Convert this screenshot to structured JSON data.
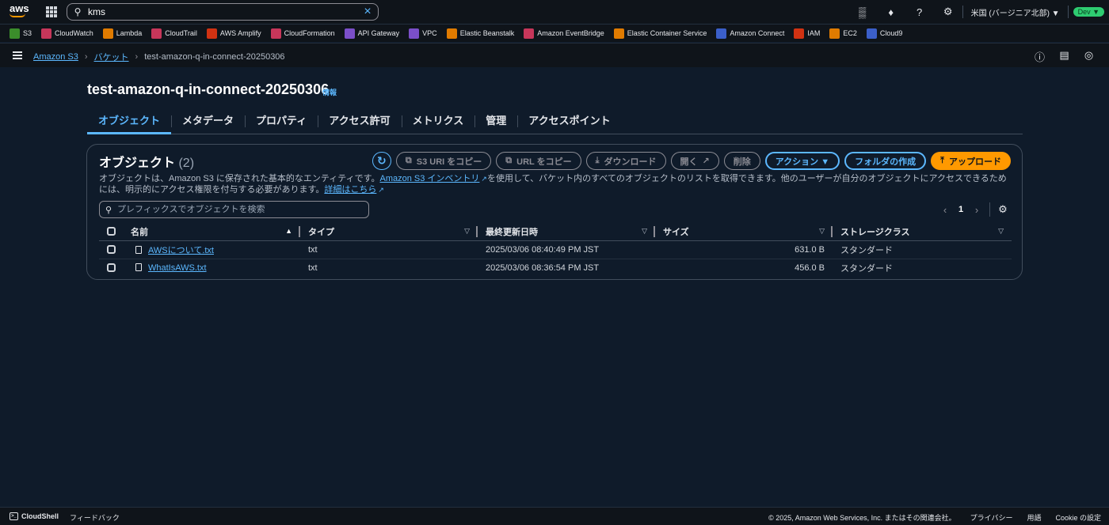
{
  "topnav": {
    "logo": "aws",
    "search_value": "kms",
    "region": "米国 (バージニア北部) ▼",
    "env": "Dev ▼",
    "icons": [
      "cloudshell-icon",
      "bell-icon",
      "help-icon",
      "gear-icon"
    ]
  },
  "favorites": [
    {
      "label": "S3",
      "color": "#3b8d2b"
    },
    {
      "label": "CloudWatch",
      "color": "#c7365a"
    },
    {
      "label": "Lambda",
      "color": "#e07b00"
    },
    {
      "label": "CloudTrail",
      "color": "#c7365a"
    },
    {
      "label": "AWS Amplify",
      "color": "#d13212"
    },
    {
      "label": "CloudFormation",
      "color": "#c7365a"
    },
    {
      "label": "API Gateway",
      "color": "#7b4fc9"
    },
    {
      "label": "VPC",
      "color": "#7b4fc9"
    },
    {
      "label": "Elastic Beanstalk",
      "color": "#e07b00"
    },
    {
      "label": "Amazon EventBridge",
      "color": "#c7365a"
    },
    {
      "label": "Elastic Container Service",
      "color": "#e07b00"
    },
    {
      "label": "Amazon Connect",
      "color": "#3b5fc9"
    },
    {
      "label": "IAM",
      "color": "#d13212"
    },
    {
      "label": "EC2",
      "color": "#e07b00"
    },
    {
      "label": "Cloud9",
      "color": "#3b5fc9"
    }
  ],
  "breadcrumb": {
    "root": "Amazon S3",
    "buckets": "バケット",
    "current": "test-amazon-q-in-connect-20250306"
  },
  "page": {
    "title": "test-amazon-q-in-connect-20250306",
    "info": "情報"
  },
  "tabs": [
    "オブジェクト",
    "メタデータ",
    "プロパティ",
    "アクセス許可",
    "メトリクス",
    "管理",
    "アクセスポイント"
  ],
  "panel": {
    "title": "オブジェクト",
    "count": "(2)",
    "buttons": {
      "copy_s3_uri": "S3 URI をコピー",
      "copy_url": "URL をコピー",
      "download": "ダウンロード",
      "open": "開く",
      "delete": "削除",
      "actions": "アクション ▼",
      "create_folder": "フォルダの作成",
      "upload": "アップロード"
    },
    "desc_part1": "オブジェクトは、Amazon S3 に保存された基本的なエンティティです。",
    "desc_link1": "Amazon S3 インベントリ",
    "desc_part2": "を使用して、バケット内のすべてのオブジェクトのリストを取得できます。他のユーザーが自分のオブジェクトにアクセスできるためには、明示的にアクセス権限を付与する必要があります。",
    "desc_link2": "詳細はこちら",
    "filter_placeholder": "プレフィックスでオブジェクトを検索",
    "page_number": "1"
  },
  "table": {
    "columns": [
      "名前",
      "タイプ",
      "最終更新日時",
      "サイズ",
      "ストレージクラス"
    ],
    "rows": [
      {
        "name": "AWSについて.txt",
        "type": "txt",
        "modified": "2025/03/06 08:40:49 PM JST",
        "size": "631.0 B",
        "storage": "スタンダード"
      },
      {
        "name": "WhatIsAWS.txt",
        "type": "txt",
        "modified": "2025/03/06 08:36:54 PM JST",
        "size": "456.0 B",
        "storage": "スタンダード"
      }
    ]
  },
  "footer": {
    "cloudshell": "CloudShell",
    "feedback": "フィードバック",
    "copyright": "© 2025, Amazon Web Services, Inc. またはその関連会社。",
    "privacy": "プライバシー",
    "terms": "用語",
    "cookie": "Cookie の設定"
  }
}
